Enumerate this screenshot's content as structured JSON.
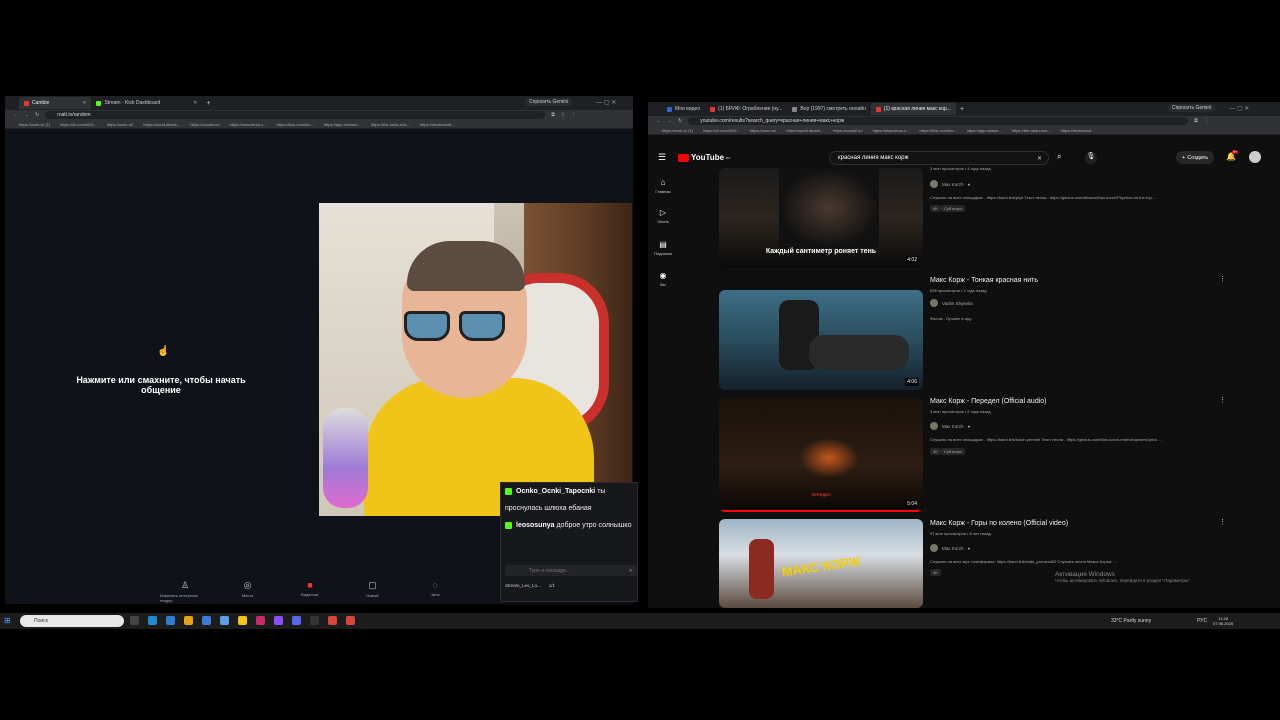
{
  "left_browser": {
    "tabs": [
      {
        "label": "Cambie",
        "active": true
      },
      {
        "label": "Stream - Kick Dashboard",
        "active": false
      }
    ],
    "gemini_label": "Спросить Gemini",
    "url": "roalt.tv/random",
    "bookmarks": [
      "https://mail.ru/ (1)",
      "https://vk.com/id19...",
      "https://ozon.ru/",
      "https://world.dbank...",
      "https://vocabl.ru/",
      "https://www.temu.c...",
      "https://kick.com/leo...",
      "https://app.roniwee...",
      "https://the-radio.ru/s...",
      "https://deotionsoft..."
    ]
  },
  "roulette": {
    "prompt": "Нажмите или смахните, чтобы начать общение",
    "bottom_nav": [
      "Изменить интересы/гендер",
      "Место",
      "Видеочат",
      "Новый",
      "Чаты"
    ]
  },
  "chat": {
    "messages": [
      {
        "user": "Ocnko_Ocnki_Tapocnki",
        "text": "ты проснулась шлюха ебаная"
      },
      {
        "user": "leososunya",
        "text": "доброе утро солнышко"
      }
    ],
    "input_placeholder": "Type a message...",
    "stream_label": "Stream_Leo_Lo...",
    "count": "1/1"
  },
  "right_browser": {
    "tabs": [
      {
        "label": "Мои видео",
        "active": false
      },
      {
        "label": "(1) БРИФ: Ограбление (ну...",
        "active": false
      },
      {
        "label": "Вор (1997) смотреть онлайн",
        "active": false
      },
      {
        "label": "(1) красная линия макс кор...",
        "active": true
      }
    ],
    "gemini_label": "Спросить Gemini",
    "url": "youtube.com/results?search_query=красная+линия+макс+корж",
    "bookmarks": [
      "https://mail.ru/ (1)",
      "https://vk.com/id19...",
      "https://ozon.ru/",
      "https://world.dbank...",
      "https://vocabl.ru/",
      "https://www.temu.c...",
      "https://kick.com/leo...",
      "https://app.roniwe...",
      "https://the-radio.ru/s...",
      "https://deotionsof..."
    ]
  },
  "youtube": {
    "logo": "YouTube",
    "region": "RU",
    "search_query": "красная линия макс корж",
    "create_label": "Создать",
    "notifications": "9+",
    "sidebar": [
      "Главная",
      "Shorts",
      "Подписки",
      "Вы"
    ],
    "results": [
      {
        "title": "",
        "meta": "3 млн просмотров • 4 года назад",
        "channel": "Max Korzh",
        "description": "Слушать на всех площадках - https://band.link/psyt Текст песни - https://genius.com/albums/Max-korzh/Psychos-hit-the-top...",
        "duration": "4:02",
        "overlay": "Каждый сантиметр роняет тень",
        "badges": [
          "4K",
          "Субтитры"
        ]
      },
      {
        "title": "Макс Корж - Тонкая красная нить",
        "meta": "698 просмотров • 2 года назад",
        "channel": "Vadim Shykelia",
        "description": "Фоном - Лучшее в аду.",
        "duration": "4:06",
        "overlay": "",
        "badges": []
      },
      {
        "title": "Макс Корж - Передел (Official audio)",
        "meta": "3 млн просмотров • 2 года назад",
        "channel": "Max Korzh",
        "description": "Слушать на всех площадках - https://band.link/korzh.peredel Текст песни - https://genius.com/Max-korzh-redevelopment-lyrics ...",
        "duration": "5:04",
        "overlay": "ПЕРЕДЕЛ",
        "badges": [
          "4K",
          "Субтитры"
        ]
      },
      {
        "title": "Макс Корж - Горы по колено (Official video)",
        "meta": "97 млн просмотров • 8 лет назад",
        "channel": "Max Korzh",
        "description": "Слушать на всех муз. платформах: https://band.link/maki_porosrodil2 Слушать песни Макса Коржа: ...",
        "duration": "",
        "overlay": "МАКС КОРЖ",
        "badges": [
          "4K"
        ]
      }
    ]
  },
  "windows_activation": {
    "title": "Активация Windows",
    "subtitle": "Чтобы активировать Windows, перейдите в раздел \"Параметры\"."
  },
  "taskbar": {
    "search_placeholder": "Поиск",
    "weather": "33°C  Partly sunny",
    "lang": "РУС",
    "time": "11:28",
    "date": "07.08.2025"
  }
}
